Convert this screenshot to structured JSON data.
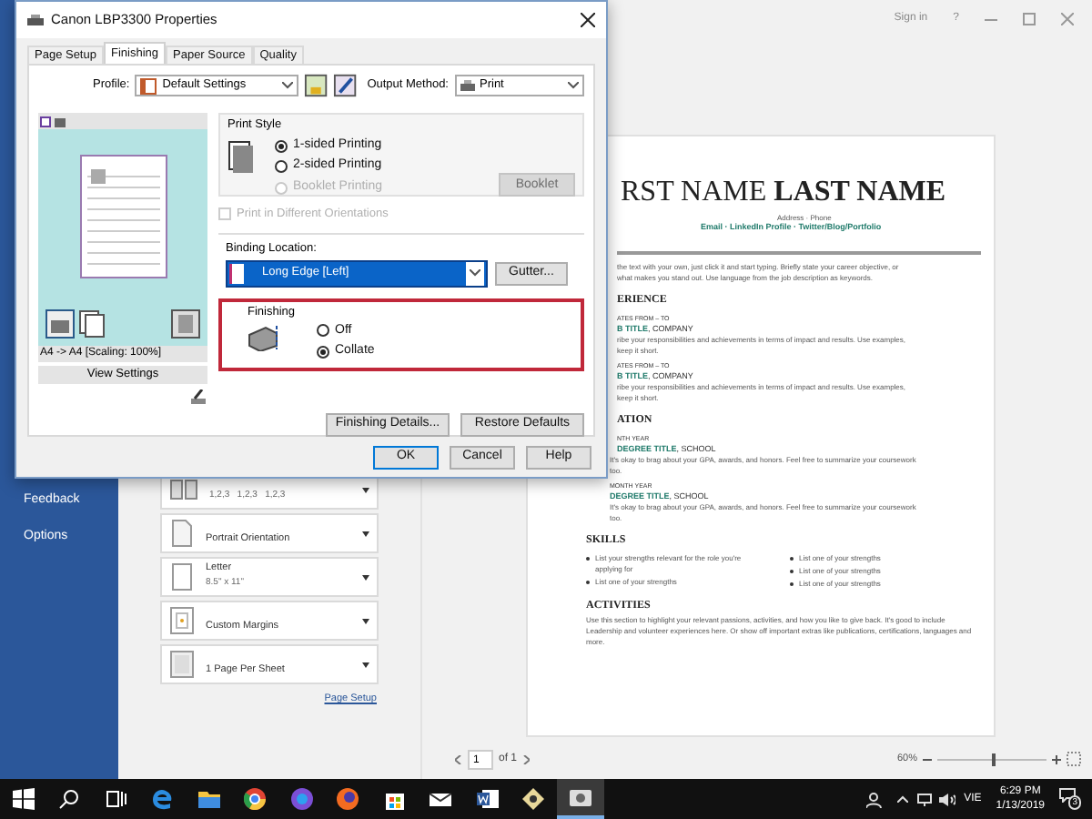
{
  "backstage": {
    "top_bar": {
      "sign_in": "Sign in",
      "help": "?"
    },
    "sidebar": [
      {
        "label": "Feedback"
      },
      {
        "label": "Options"
      }
    ],
    "settings": [
      {
        "kind": "collate",
        "subtitle": "1,2,3   1,2,3   1,2,3"
      },
      {
        "kind": "orientation",
        "title": "Portrait Orientation"
      },
      {
        "kind": "paper",
        "title": "Letter",
        "subtitle": "8.5\" x 11\""
      },
      {
        "kind": "margins",
        "title": "Custom Margins"
      },
      {
        "kind": "sheet",
        "title": "1 Page Per Sheet"
      }
    ],
    "page_setup_link": "Page Setup",
    "resume_upper": [
      {
        "kind": "name",
        "text": "RST NAME **LAST NAME**"
      },
      {
        "kind": "small",
        "text": "Address · Phone"
      },
      {
        "kind": "contact",
        "text": "Email · LinkedIn Profile · Twitter/Blog/Portfolio"
      },
      {
        "kind": "rule"
      },
      {
        "kind": "body",
        "lines": [
          "the text with your own, just click it and start typing. Briefly state your career objective, or",
          "what makes you stand out. Use language from the job description as keywords."
        ]
      },
      {
        "kind": "heading",
        "text": "ERIENCE"
      },
      {
        "kind": "date",
        "text": "ATES FROM – TO"
      },
      {
        "kind": "role",
        "title": "B TITLE",
        "place": ", COMPANY"
      },
      {
        "kind": "body",
        "lines": [
          "ribe your responsibilities and achievements in terms of impact and results. Use examples,",
          "keep it short."
        ]
      },
      {
        "kind": "date",
        "text": "ATES FROM – TO"
      },
      {
        "kind": "role",
        "title": "B TITLE",
        "place": ", COMPANY"
      },
      {
        "kind": "body",
        "lines": [
          "ribe your responsibilities and achievements in terms of impact and results. Use examples,",
          "keep it short."
        ]
      },
      {
        "kind": "heading",
        "text": "ATION"
      },
      {
        "kind": "date",
        "text": "NTH YEAR"
      },
      {
        "kind": "role",
        "title": "DEGREE TITLE",
        "place": ", SCHOOL"
      }
    ],
    "resume_lower": [
      {
        "kind": "body",
        "lines": [
          "It's okay to brag about your GPA, awards, and honors. Feel free to summarize your coursework",
          "too."
        ]
      },
      {
        "kind": "date",
        "text": "MONTH YEAR"
      },
      {
        "kind": "role",
        "title": "DEGREE TITLE",
        "place": ", SCHOOL"
      },
      {
        "kind": "body",
        "lines": [
          "It's okay to brag about your GPA, awards, and honors. Feel free to summarize your coursework",
          "too."
        ]
      },
      {
        "kind": "section",
        "text": "SKILLS"
      },
      {
        "kind": "skills",
        "columns": [
          [
            "List your strengths relevant for the role you're applying for",
            "List one of your strengths"
          ],
          [
            "List one of your strengths",
            "List one of your strengths",
            "List one of your strengths"
          ]
        ]
      },
      {
        "kind": "section",
        "text": "ACTIVITIES"
      },
      {
        "kind": "paragraph",
        "text": "Use this section to highlight your relevant passions, activities, and how you like to give back. It's good to include Leadership and volunteer experiences here. Or show off important extras like publications, certifications, languages and more."
      }
    ],
    "page_nav": {
      "page": "1",
      "of": "of 1"
    },
    "zoom": {
      "reading": "60%",
      "level": 0.5
    }
  },
  "dialog": {
    "title": "Canon LBP3300 Properties",
    "tabs": [
      {
        "label": "Page Setup",
        "selected": false
      },
      {
        "label": "Finishing",
        "selected": true
      },
      {
        "label": "Paper Source",
        "selected": false
      },
      {
        "label": "Quality",
        "selected": false
      }
    ],
    "profile": {
      "label": "Profile:",
      "value": "Default Settings"
    },
    "output_method": {
      "label": "Output Method:",
      "value": "Print"
    },
    "preview_caption": "A4 -> A4 [Scaling: 100%]",
    "view_settings": "View Settings",
    "print_style": {
      "title": "Print Style",
      "options": [
        {
          "label": "1-sided Printing",
          "selected": true,
          "disabled": false
        },
        {
          "label": "2-sided Printing",
          "selected": false,
          "disabled": false
        },
        {
          "label": "Booklet Printing",
          "selected": false,
          "disabled": true
        }
      ],
      "booklet": {
        "label": "Booklet",
        "disabled": true
      }
    },
    "orientations": {
      "label": "Print in Different Orientations",
      "checked": false,
      "disabled": true
    },
    "binding": {
      "label": "Binding Location:",
      "value": "Long Edge [Left]",
      "focused": true,
      "gutter": "Gutter..."
    },
    "finishing": {
      "title": "Finishing",
      "highlighted": true,
      "options": [
        {
          "label": "Off",
          "selected": false
        },
        {
          "label": "Collate",
          "selected": true
        }
      ]
    },
    "panel_buttons": [
      "Finishing Details...",
      "Restore Defaults"
    ],
    "buttons": [
      {
        "label": "OK",
        "default": true
      },
      {
        "label": "Cancel",
        "default": false
      },
      {
        "label": "Help",
        "default": false
      }
    ]
  },
  "taskbar": {
    "apps": [
      {
        "kind": "start",
        "selected": false
      },
      {
        "kind": "search",
        "selected": false
      },
      {
        "kind": "taskview",
        "selected": false
      },
      {
        "kind": "browser",
        "selected": false
      },
      {
        "kind": "folder",
        "selected": false
      },
      {
        "kind": "ring",
        "selected": false
      },
      {
        "kind": "orb",
        "selected": false
      },
      {
        "kind": "fox",
        "selected": false
      },
      {
        "kind": "bag",
        "selected": false
      },
      {
        "kind": "mail",
        "selected": false
      },
      {
        "kind": "doc",
        "selected": false
      },
      {
        "kind": "eye",
        "selected": false
      },
      {
        "kind": "camera",
        "selected": true
      }
    ],
    "language": "VIE",
    "time": "6:29 PM",
    "date": "1/13/2019",
    "notifications": "3"
  }
}
